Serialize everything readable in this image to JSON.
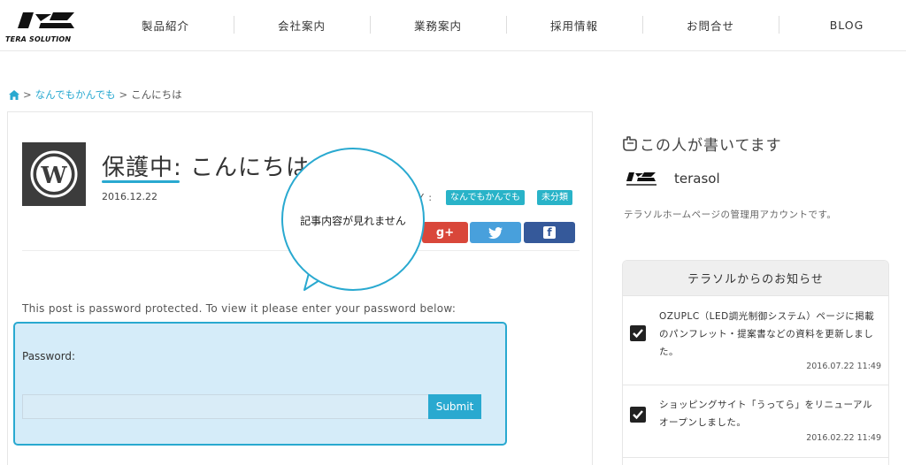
{
  "header": {
    "logo_text": "TERA SOLUTION",
    "nav": [
      "製品紹介",
      "会社案内",
      "業務案内",
      "採用情報",
      "お問合せ",
      "BLOG"
    ]
  },
  "breadcrumb": {
    "items": [
      "なんでもかんでも",
      "こんにちは"
    ],
    "separator": ">"
  },
  "post": {
    "title": "保護中: こんにちは",
    "date": "2016.12.22",
    "category_label": "RY :",
    "categories": [
      "なんでもかんでも",
      "未分類"
    ],
    "share": {
      "google_label": "g+",
      "facebook_label": "f"
    },
    "protected_text": "This post is password protected. To view it please enter your password below:",
    "password_label": "Password:",
    "password_value": "",
    "submit_label": "Submit"
  },
  "bubble": {
    "text": "記事内容が見れません"
  },
  "author": {
    "heading": "この人が書いてます",
    "name": "terasol",
    "description": "テラソルホームページの管理用アカウントです。"
  },
  "news": {
    "title": "テラソルからのお知らせ",
    "items": [
      {
        "text": "OZUPLC（LED調光制御システム）ページに掲載のパンフレット・提案書などの資料を更新しました。",
        "date": "2016.07.22 11:49"
      },
      {
        "text": "ショッピングサイト「うってら」をリニューアルオープンしました。",
        "date": "2016.02.22 11:49"
      }
    ]
  },
  "colors": {
    "accent": "#29a9d0",
    "google": "#d9473a",
    "twitter": "#48a0dc",
    "facebook": "#35599a",
    "tag": "#29b3c8"
  }
}
